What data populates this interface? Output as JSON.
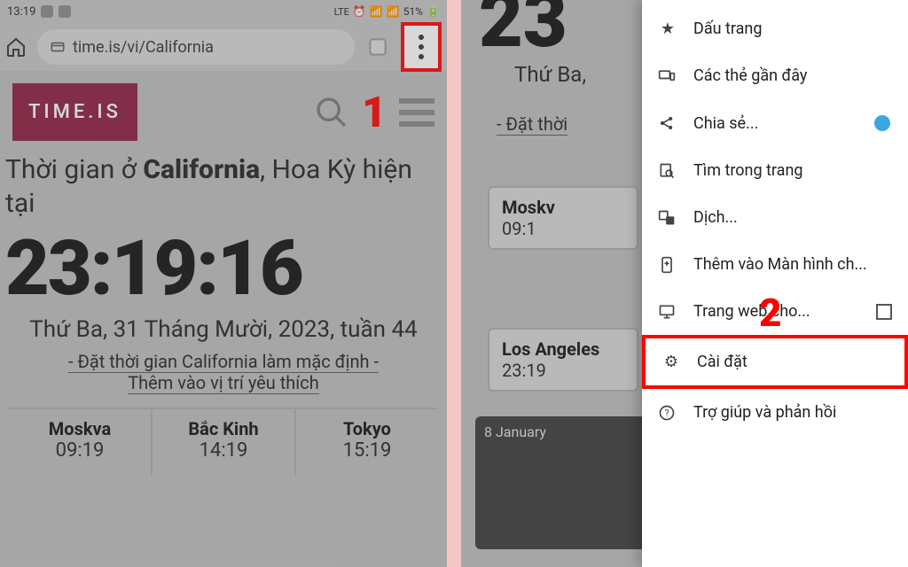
{
  "statusbar": {
    "time": "13:19",
    "battery": "51%",
    "net_label": "LTE"
  },
  "browser": {
    "url": "time.is/vi/California"
  },
  "annotations": {
    "step1": "1",
    "step2": "2"
  },
  "site": {
    "logo": "TIME.IS",
    "title_prefix": "Thời gian ở ",
    "title_bold": "California",
    "title_suffix": ", Hoa Kỳ hiện tại",
    "clock": "23:19:16",
    "date": "Thứ Ba, 31 Tháng Mười, 2023, tuần 44",
    "link_default": "- Đặt thời gian California làm mặc định -",
    "link_fav": "Thêm vào vị trí yêu thích"
  },
  "cities": [
    {
      "name": "Moskva",
      "time": "09:19"
    },
    {
      "name": "Bắc Kinh",
      "time": "14:19"
    },
    {
      "name": "Tokyo",
      "time": "15:19"
    }
  ],
  "right_peek": {
    "clock": "23",
    "date": "Thứ Ba,",
    "link": "- Đặt thời",
    "card1_name": "Moskv",
    "card1_time": "09:1",
    "card2_name": "Los Angeles",
    "card2_time": "23:19",
    "video_date": "8 January"
  },
  "menu": {
    "bookmark": "Dấu trang",
    "recent_tabs": "Các thẻ gần đây",
    "share": "Chia sẻ...",
    "find": "Tìm trong trang",
    "translate": "Dịch...",
    "add_home": "Thêm vào Màn hình ch...",
    "desktop_site": "Trang web cho...",
    "settings": "Cài đặt",
    "help": "Trợ giúp và phản hồi"
  }
}
